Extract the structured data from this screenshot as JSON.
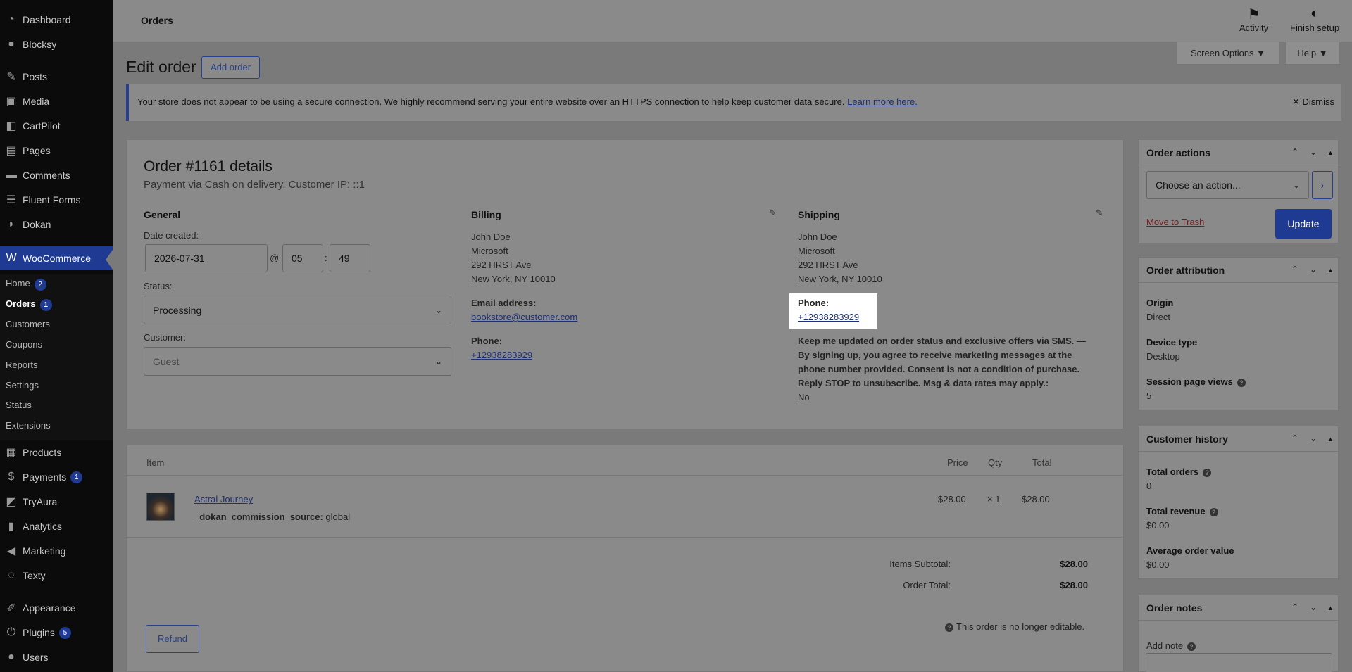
{
  "sidebar": {
    "items": [
      {
        "label": "Dashboard",
        "icon": "dashboard-icon"
      },
      {
        "label": "Blocksy",
        "icon": "blocksy-icon"
      },
      {
        "label": "Posts",
        "icon": "pin-icon"
      },
      {
        "label": "Media",
        "icon": "media-icon"
      },
      {
        "label": "CartPilot",
        "icon": "cartpilot-icon"
      },
      {
        "label": "Pages",
        "icon": "pages-icon"
      },
      {
        "label": "Comments",
        "icon": "comments-icon"
      },
      {
        "label": "Fluent Forms",
        "icon": "forms-icon"
      },
      {
        "label": "Dokan",
        "icon": "dokan-icon"
      },
      {
        "label": "WooCommerce",
        "icon": "woocommerce-icon"
      },
      {
        "label": "Products",
        "icon": "products-icon"
      },
      {
        "label": "Payments",
        "icon": "payments-icon",
        "badge": "1"
      },
      {
        "label": "TryAura",
        "icon": "tryaura-icon"
      },
      {
        "label": "Analytics",
        "icon": "analytics-icon"
      },
      {
        "label": "Marketing",
        "icon": "marketing-icon"
      },
      {
        "label": "Texty",
        "icon": "texty-icon"
      },
      {
        "label": "Appearance",
        "icon": "appearance-icon"
      },
      {
        "label": "Plugins",
        "icon": "plugins-icon",
        "badge": "5"
      },
      {
        "label": "Users",
        "icon": "users-icon"
      }
    ],
    "submenu": [
      {
        "label": "Home",
        "badge": "2"
      },
      {
        "label": "Orders",
        "badge": "1"
      },
      {
        "label": "Customers"
      },
      {
        "label": "Coupons"
      },
      {
        "label": "Reports"
      },
      {
        "label": "Settings"
      },
      {
        "label": "Status"
      },
      {
        "label": "Extensions"
      }
    ]
  },
  "topbar": {
    "title": "Orders",
    "activity": "Activity",
    "finish_setup": "Finish setup",
    "screen_options": "Screen Options ▼",
    "help": "Help ▼"
  },
  "page": {
    "heading": "Edit order",
    "add_order": "Add order"
  },
  "notice": {
    "text": "Your store does not appear to be using a secure connection. We highly recommend serving your entire website over an HTTPS connection to help keep customer data secure. ",
    "link": "Learn more here.",
    "dismiss": "Dismiss"
  },
  "order": {
    "title": "Order #1161 details",
    "subtitle": "Payment via Cash on delivery. Customer IP: ::1",
    "general": {
      "heading": "General",
      "date_label": "Date created:",
      "date": "2026-07-31",
      "at": "@",
      "hour": "05",
      "colon": ":",
      "minute": "49",
      "status_label": "Status:",
      "status": "Processing",
      "customer_label": "Customer:",
      "customer": "Guest"
    },
    "billing": {
      "heading": "Billing",
      "name": "John Doe",
      "company": "Microsoft",
      "street": "292 HRST Ave",
      "city": "New York, NY 10010",
      "email_label": "Email address:",
      "email": "bookstore@customer.com",
      "phone_label": "Phone:",
      "phone": "+12938283929"
    },
    "shipping": {
      "heading": "Shipping",
      "name": "John Doe",
      "company": "Microsoft",
      "street": "292 HRST Ave",
      "city": "New York, NY 10010",
      "phone_label": "Phone:",
      "phone": "+12938283929",
      "sms_line1": "Keep me updated on order status and exclusive offers via SMS. —",
      "sms_line2": "By signing up, you agree to receive marketing messages at the",
      "sms_line3": "phone number provided. Consent is not a condition of purchase.",
      "sms_line4": "Reply STOP to unsubscribe. Msg & data rates may apply.:",
      "sms_value": "No"
    }
  },
  "items": {
    "headers": {
      "item": "Item",
      "price": "Price",
      "qty": "Qty",
      "total": "Total"
    },
    "rows": [
      {
        "name": "Astral Journey",
        "meta_key": "_dokan_commission_source:",
        "meta_val": "global",
        "price": "$28.00",
        "qty": "× 1",
        "total": "$28.00"
      }
    ],
    "subtotal_label": "Items Subtotal:",
    "subtotal": "$28.00",
    "total_label": "Order Total:",
    "total": "$28.00",
    "refund": "Refund",
    "not_editable": "This order is no longer editable."
  },
  "actions": {
    "heading": "Order actions",
    "select": "Choose an action...",
    "trash": "Move to Trash",
    "update": "Update"
  },
  "attribution": {
    "heading": "Order attribution",
    "origin_label": "Origin",
    "origin": "Direct",
    "device_label": "Device type",
    "device": "Desktop",
    "views_label": "Session page views",
    "views": "5"
  },
  "history": {
    "heading": "Customer history",
    "orders_label": "Total orders",
    "orders": "0",
    "revenue_label": "Total revenue",
    "revenue": "$0.00",
    "aov_label": "Average order value",
    "aov": "$0.00"
  },
  "notes": {
    "heading": "Order notes",
    "add_note": "Add note"
  }
}
